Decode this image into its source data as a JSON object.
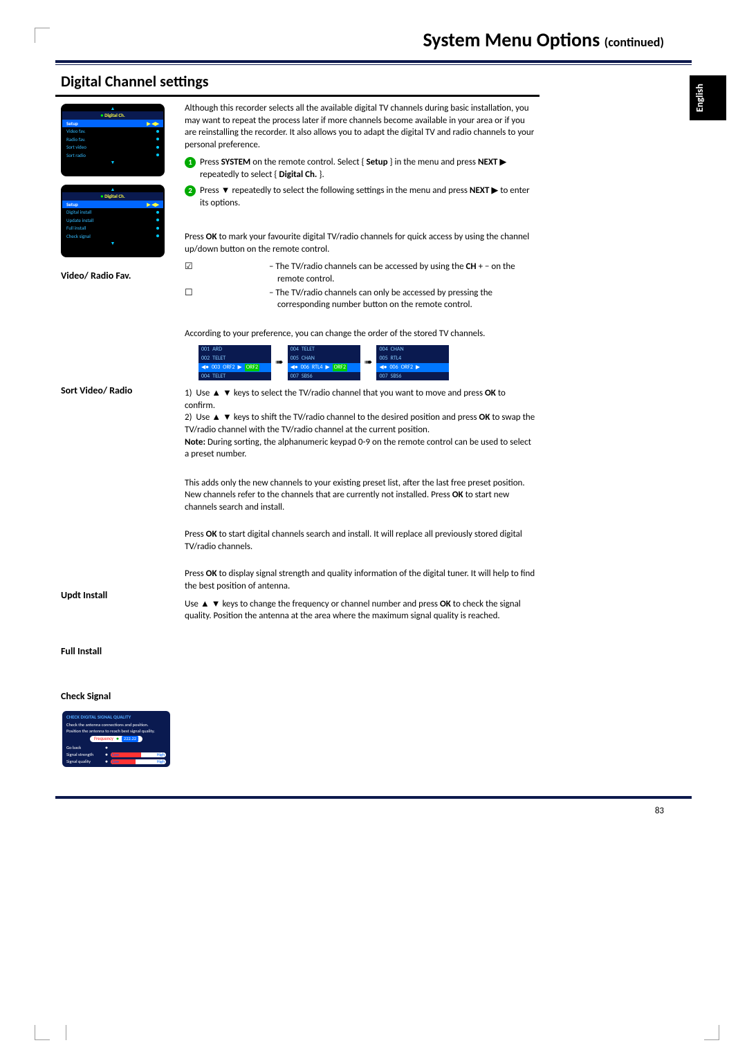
{
  "title_main": "System Menu Options ",
  "title_sub": "(continued)",
  "language_tab": "English",
  "section_header": "Digital Channel settings",
  "page_number": "83",
  "intro_para": "Although this recorder selects all the available digital TV channels during basic installation, you may want to repeat the process later if more channels become available in your area or if you are reinstalling the recorder.  It also allows you to adapt the digital TV and radio channels to your personal preference.",
  "step1_a": "Press ",
  "step1_b": "SYSTEM",
  "step1_c": " on the remote control. Select { ",
  "step1_d": "Setup",
  "step1_e": " } in the menu and press ",
  "step1_f": "NEXT",
  "step1_g": " ▶ repeatedly to select { ",
  "step1_h": "Digital Ch.",
  "step1_i": " }.",
  "step2_a": "Press ▼ repeatedly to select the following settings in the menu and press ",
  "step2_b": "NEXT",
  "step2_c": " ▶ to enter its options.",
  "mini1_title": "Digital Ch.",
  "mini1_items": [
    "Setup",
    "Video fav.",
    "Radio fav.",
    "Sort video",
    "Sort radio"
  ],
  "mini2_title": "Digital Ch.",
  "mini2_items": [
    "Setup",
    "Digital install",
    "Update install",
    "Full install",
    "Check signal"
  ],
  "heads": {
    "vrf": "Video/ Radio Fav.",
    "svr": "Sort Video/ Radio",
    "upd": "Updt Install",
    "full": "Full Install",
    "chk": "Check Signal"
  },
  "vrf_intro_a": "Press ",
  "vrf_intro_b": "OK",
  "vrf_intro_c": " to mark your favourite digital TV/radio channels for quick access by using the channel up/down button on the remote control.",
  "vrf_check1_a": "– The TV/radio channels can be accessed by using the ",
  "vrf_check1_b": "CH",
  "vrf_check1_c": " + − on the remote control.",
  "vrf_check2": "– The TV/radio channels can only be accessed by pressing the corresponding number button on the remote control.",
  "svr_intro": "According to your preference, you can change the order of the stored TV channels.",
  "sort_t1": [
    [
      "001",
      "ARD"
    ],
    [
      "002",
      "TELET"
    ],
    [
      "003",
      "ORF2"
    ],
    [
      "004",
      "TELET"
    ]
  ],
  "sort_badge1": "ORF2",
  "sort_t2": [
    [
      "004",
      "TELET"
    ],
    [
      "005",
      "CHAN"
    ],
    [
      "006",
      "RTL4"
    ],
    [
      "007",
      "SBS6"
    ]
  ],
  "sort_badge2": "ORF2",
  "sort_t3": [
    [
      "004",
      "CHAN"
    ],
    [
      "005",
      "RTL4"
    ],
    [
      "006",
      "ORF2"
    ],
    [
      "007",
      "SBS6"
    ]
  ],
  "svr_li1_a": "Use ▲ ▼ keys to select the TV/radio channel that you want to move and press ",
  "svr_li1_b": "OK",
  "svr_li1_c": " to confirm.",
  "svr_li2_a": "Use ▲ ▼ keys to shift the TV/radio channel to the desired position and press ",
  "svr_li2_b": "OK",
  "svr_li2_c": " to swap the TV/radio channel with the TV/radio channel at the current position.",
  "svr_note_a": "Note:",
  "svr_note_b": "  During sorting, the alphanumeric keypad 0-9 on the remote control can be used to select a preset number.",
  "upd_text_a": "This adds only the new channels to your existing preset list, after the last free preset position.  New channels refer to the channels that are currently not installed.  Press ",
  "upd_text_b": "OK",
  "upd_text_c": " to start new channels search and install.",
  "full_text_a": "Press ",
  "full_text_b": "OK",
  "full_text_c": " to start digital channels search and install.  It will replace all previously stored digital TV/radio channels.",
  "chk_text_a": "Press ",
  "chk_text_b": "OK",
  "chk_text_c": " to display signal strength and quality information of the digital tuner.  It will help to find the best position of antenna.",
  "chk_text_d": "Use ▲ ▼ keys to change the frequency or channel number and press ",
  "chk_text_e": "OK",
  "chk_text_f": " to check the signal quality.  Position the antenna at the area where the maximum signal quality is reached.",
  "signal": {
    "title": "CHECK DIGITAL SIGNAL QUALITY",
    "l1": "Check the antenna connections and position.",
    "l2": "Position the antenna to reach best signal quality.",
    "freq_label": "Frequency",
    "freq_val": "222.22",
    "goback": "Go back",
    "strength": "Signal strength",
    "quality": "Signal quality",
    "low": "Low",
    "high": "High"
  }
}
